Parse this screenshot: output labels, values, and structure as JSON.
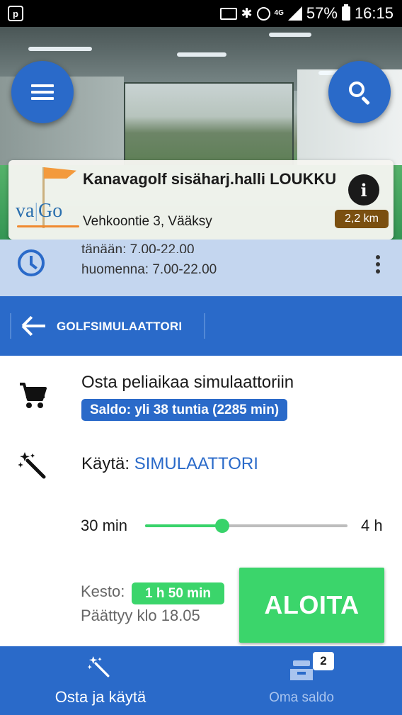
{
  "status_bar": {
    "network": "4G",
    "battery": "57%",
    "time": "16:15"
  },
  "venue": {
    "logo_text": "vaGo",
    "name": "Kanavagolf sisäharj.halli LOUKKU",
    "address": "Vehkoontie 3, Vääksy",
    "distance": "2,2 km"
  },
  "hours": {
    "today": "tänään: 7.00-22.00",
    "tomorrow": "huomenna: 7.00-22.00"
  },
  "section": {
    "title": "GOLFSIMULAATTORI"
  },
  "purchase": {
    "title": "Osta peliaikaa simulaattoriin",
    "balance": "Saldo: yli 38 tuntia (2285 min)"
  },
  "use": {
    "label": "Käytä:",
    "target": "SIMULAATTORI"
  },
  "duration_slider": {
    "min_label": "30 min",
    "max_label": "4 h",
    "value_fraction": 0.38
  },
  "duration": {
    "label": "Kesto:",
    "value": "1 h 50 min",
    "ends": "Päättyy klo 18.05",
    "start_label": "ALOITA"
  },
  "bottom_nav": {
    "buy_label": "Osta ja käytä",
    "balance_label": "Oma saldo",
    "balance_badge": "2"
  },
  "colors": {
    "primary": "#2a6ac9",
    "accent_green": "#3bd56b",
    "distance_badge": "#7a4f10",
    "hours_band": "#c4d6ef"
  },
  "icons": [
    "menu-icon",
    "search-icon",
    "info-icon",
    "clock-icon",
    "more-vertical-icon",
    "back-arrow-icon",
    "cart-icon",
    "magic-wand-icon",
    "inbox-icon"
  ]
}
